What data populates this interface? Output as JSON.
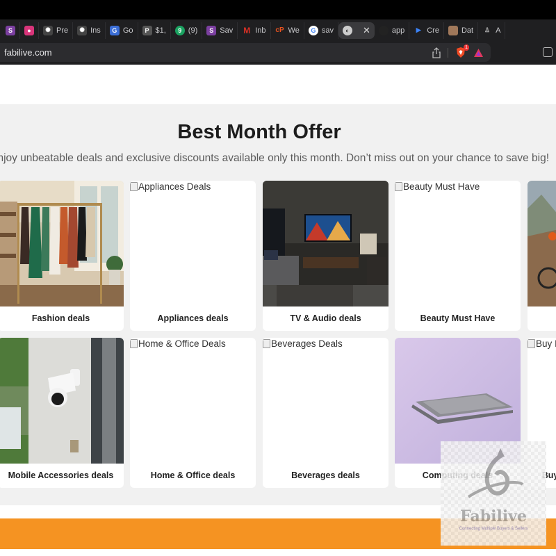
{
  "browser": {
    "tabs": [
      {
        "label": "",
        "icon": "s-app-icon",
        "color": "#7b3fa0"
      },
      {
        "label": "",
        "icon": "pink-app-icon",
        "color": "#d9357a"
      },
      {
        "label": "Pre",
        "icon": "chatgpt-icon",
        "color": "#444"
      },
      {
        "label": "Ins",
        "icon": "chatgpt-icon",
        "color": "#444"
      },
      {
        "label": "Go",
        "icon": "translate-icon",
        "color": "#3b6ed6"
      },
      {
        "label": "$1,",
        "icon": "p-icon",
        "color": "#555"
      },
      {
        "label": "(9)",
        "icon": "nine-icon",
        "color": "#1aa260"
      },
      {
        "label": "Sav",
        "icon": "s-app-icon",
        "color": "#7b3fa0"
      },
      {
        "label": "Inb",
        "icon": "gmail-icon",
        "color": "#d93025"
      },
      {
        "label": "We",
        "icon": "cp-icon",
        "color": "#e8531f"
      },
      {
        "label": "sav",
        "icon": "google-icon",
        "color": "#4285f4"
      },
      {
        "label": "",
        "icon": "active-tab-icon",
        "color": "#888",
        "active": true
      },
      {
        "label": "app",
        "icon": "apple-icon",
        "color": "#222"
      },
      {
        "label": "Cre",
        "icon": "play-icon",
        "color": "#3b82f6"
      },
      {
        "label": "Dat",
        "icon": "avatar-icon",
        "color": "#a0785a"
      },
      {
        "label": "A",
        "icon": "person-icon",
        "color": "#777"
      }
    ],
    "url": "fabilive.com",
    "brave_badge": "1"
  },
  "offer": {
    "title": "Best Month Offer",
    "subtitle": "Enjoy unbeatable deals and exclusive discounts available only this month. Don’t miss out on your chance to save big!"
  },
  "cards_row1": [
    {
      "label": "Fashion deals",
      "image": "fashion"
    },
    {
      "label": "Appliances deals",
      "alt": "Appliances Deals"
    },
    {
      "label": "TV & Audio deals",
      "image": "tv"
    },
    {
      "label": "Beauty Must Have",
      "alt": "Beauty Must Have"
    },
    {
      "label": "",
      "image": "bike"
    }
  ],
  "cards_row2": [
    {
      "label": "Mobile Accessories deals",
      "image": "camera"
    },
    {
      "label": "Home & Office deals",
      "alt": "Home & Office Deals"
    },
    {
      "label": "Beverages deals",
      "alt": "Beverages Deals"
    },
    {
      "label": "Computing deals",
      "image": "laptop"
    },
    {
      "label": "Buy",
      "alt": "Buy I"
    }
  ],
  "watermark": {
    "brand": "Fabilive",
    "tagline": "Connecting Multiple Buyers & Sellers"
  },
  "colors": {
    "accent": "#f59322",
    "section_bg": "#f1f1f1"
  }
}
